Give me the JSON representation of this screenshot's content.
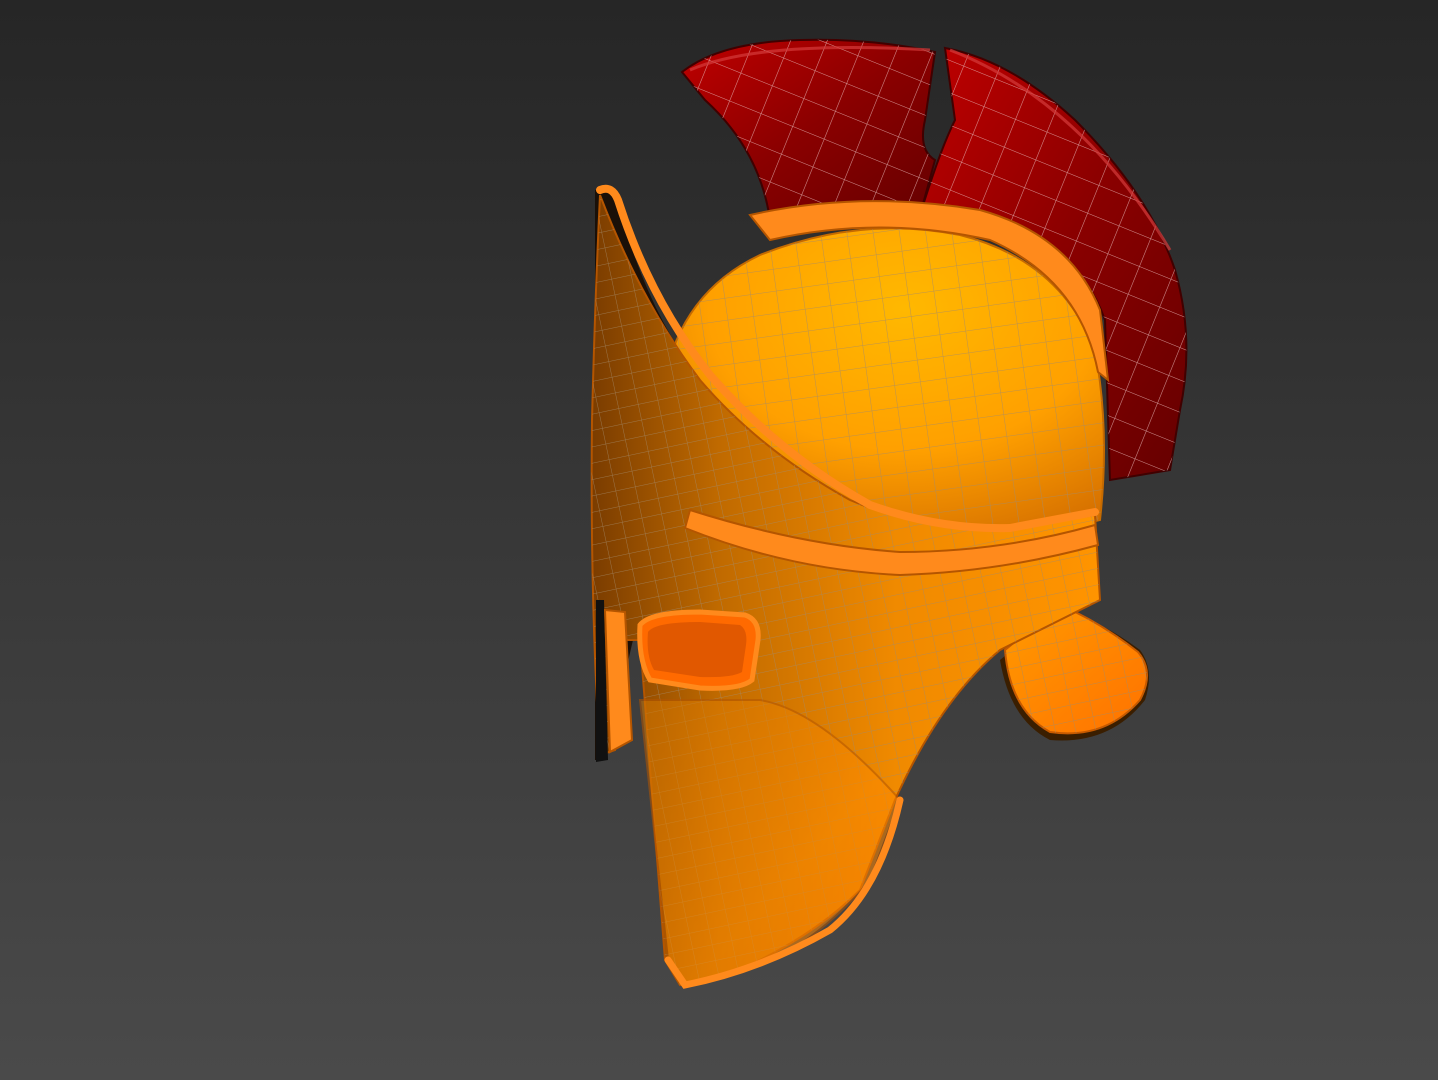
{
  "viewport": {
    "background_top": "#262626",
    "background_bottom": "#4a4a4a"
  },
  "model": {
    "name": "spartan-helmet",
    "display_mode": "shaded-with-wireframe",
    "colors": {
      "shell_light": "#ffb300",
      "shell_mid": "#ff9a00",
      "shell_dark": "#c06400",
      "shell_shadow": "#7a3c00",
      "rim": "#ff8a1c",
      "crest_light": "#b80000",
      "crest_dark": "#6e0000",
      "wire": "#a48a6a",
      "wire_crest": "#e6b7b7"
    }
  }
}
